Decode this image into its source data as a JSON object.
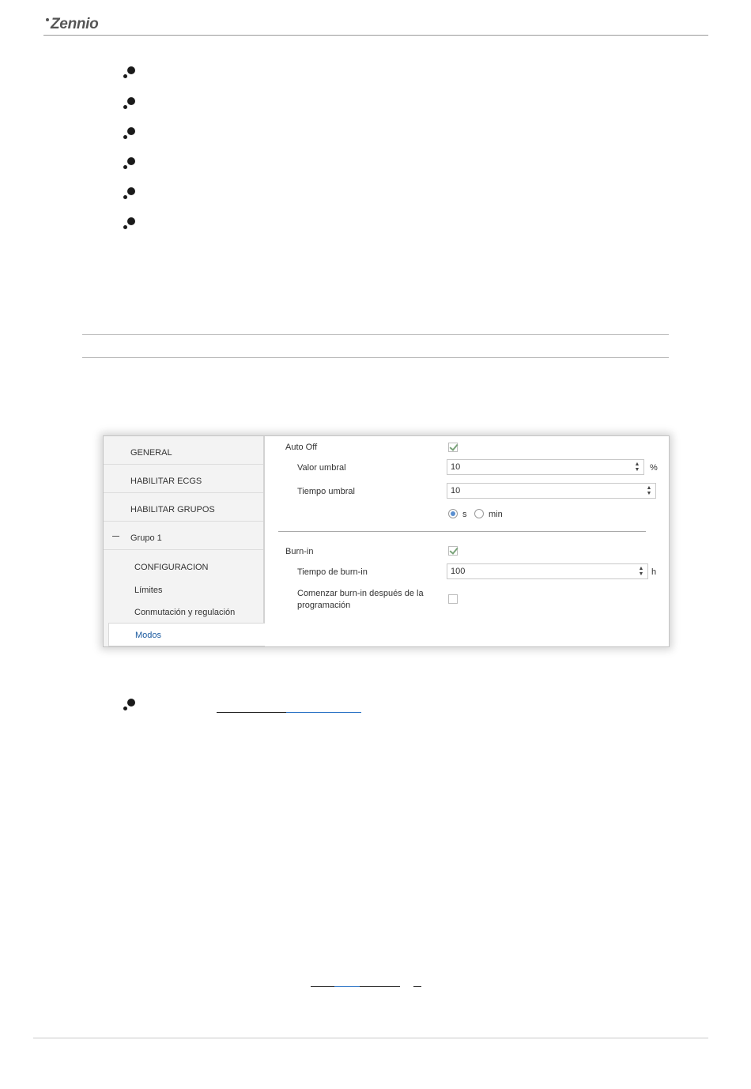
{
  "header": {
    "brand": "Zennio"
  },
  "config_panel": {
    "nav": {
      "items": [
        {
          "label": "GENERAL"
        },
        {
          "label": "HABILITAR ECGS"
        },
        {
          "label": "HABILITAR GRUPOS"
        },
        {
          "label": "Grupo 1"
        }
      ],
      "sub_items": [
        {
          "label": "CONFIGURACION"
        },
        {
          "label": "Límites"
        },
        {
          "label": "Conmutación y regulación"
        }
      ],
      "active": {
        "label": "Modos"
      }
    },
    "auto_off": {
      "label": "Auto Off",
      "checked": true,
      "threshold_value": {
        "label": "Valor umbral",
        "value": "10",
        "unit": "%"
      },
      "threshold_time": {
        "label": "Tiempo umbral",
        "value": "10"
      },
      "time_units": {
        "option_s": "s",
        "option_min": "min",
        "selected": "s"
      }
    },
    "burn_in": {
      "label": "Burn-in",
      "checked": true,
      "time": {
        "label": "Tiempo de burn-in",
        "value": "100",
        "unit": "h"
      },
      "after_programming": {
        "label_line1": "Comenzar burn-in después de la",
        "label_line2": "programación",
        "checked": false
      }
    }
  },
  "colors": {
    "accent": "#1a5aa0",
    "link": "#2a73c5",
    "check": "#7aa37a"
  }
}
